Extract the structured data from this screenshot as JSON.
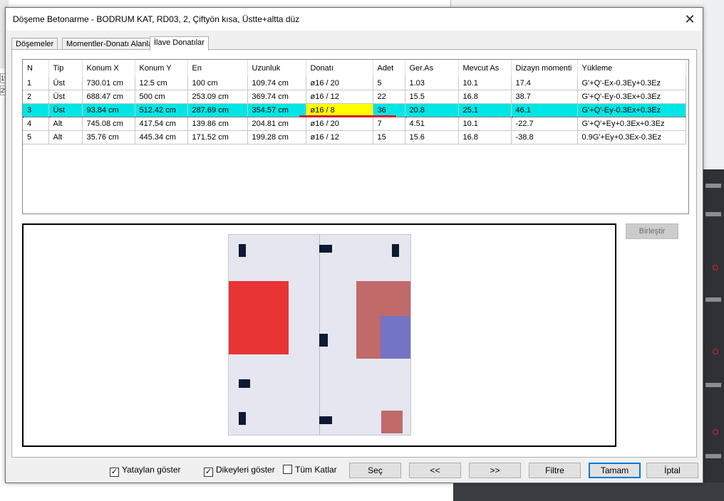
{
  "background": {
    "left_marks": [
      "19",
      "29"
    ]
  },
  "dialog": {
    "title": "Döşeme Betonarme - BODRUM KAT, RD03, 2, Çiftyön kısa, Üstte+altta düz",
    "close_glyph": "✕",
    "tabs": [
      {
        "label": "Döşemeler",
        "active": false
      },
      {
        "label": "Momentler-Donatı Alanları",
        "active": false
      },
      {
        "label": "İlave Donatılar",
        "active": true
      }
    ]
  },
  "table": {
    "columns": [
      "N",
      "Tip",
      "Konum X",
      "Konum Y",
      "En",
      "Uzunluk",
      "Donatı",
      "Adet",
      "Ger.As",
      "Mevcut As",
      "Dizayn momenti",
      "Yükleme"
    ],
    "rows": [
      [
        "1",
        "Üst",
        "730.01 cm",
        "12.5 cm",
        "100 cm",
        "109.74 cm",
        "ø16 / 20",
        "5",
        "1.03",
        "10.1",
        "17.4",
        "G'+Q'-Ex-0.3Ey+0.3Ez"
      ],
      [
        "2",
        "Üst",
        "688.47 cm",
        "500 cm",
        "253.09 cm",
        "369.74 cm",
        "ø16 / 12",
        "22",
        "15.5",
        "16.8",
        "38.7",
        "G'+Q'-Ey-0.3Ex+0.3Ez"
      ],
      [
        "3",
        "Üst",
        "93.84 cm",
        "512.42 cm",
        "287.69 cm",
        "354.57 cm",
        "ø16 / 8",
        "36",
        "20.8",
        "25.1",
        "46.1",
        "G'+Q'-Ey-0.3Ex+0.3Ez"
      ],
      [
        "4",
        "Alt",
        "745.08 cm",
        "417.54 cm",
        "139.86 cm",
        "204.81 cm",
        "ø16 / 20",
        "7",
        "4.51",
        "10.1",
        "-22.7",
        "G'+Q'+Ey+0.3Ex+0.3Ez"
      ],
      [
        "5",
        "Alt",
        "35.76 cm",
        "445.34 cm",
        "171.52 cm",
        "199.28 cm",
        "ø16 / 12",
        "15",
        "15.6",
        "16.8",
        "-38.8",
        "0.9G'+Ey+0.3Ex-0.3Ez"
      ]
    ],
    "selected_row": 3
  },
  "colors": {
    "selection": "#00e5e5",
    "highlight": "#ffff00",
    "annotation": "#d8102c",
    "zone_red": "#e83434",
    "zone_rose": "#c06a6a",
    "zone_blue": "#7474c4",
    "rebar_mark": "#0c1a33"
  },
  "buttons": {
    "merge": "Birleştir",
    "select": "Seç",
    "prev": "<<",
    "next": ">>",
    "filter": "Filtre",
    "ok": "Tamam",
    "cancel": "İptal"
  },
  "checkboxes": [
    {
      "label": "Yataylan göster",
      "checked": true
    },
    {
      "label": "Dikeyleri göster",
      "checked": true
    },
    {
      "label": "Tüm Katlar",
      "checked": false
    }
  ]
}
